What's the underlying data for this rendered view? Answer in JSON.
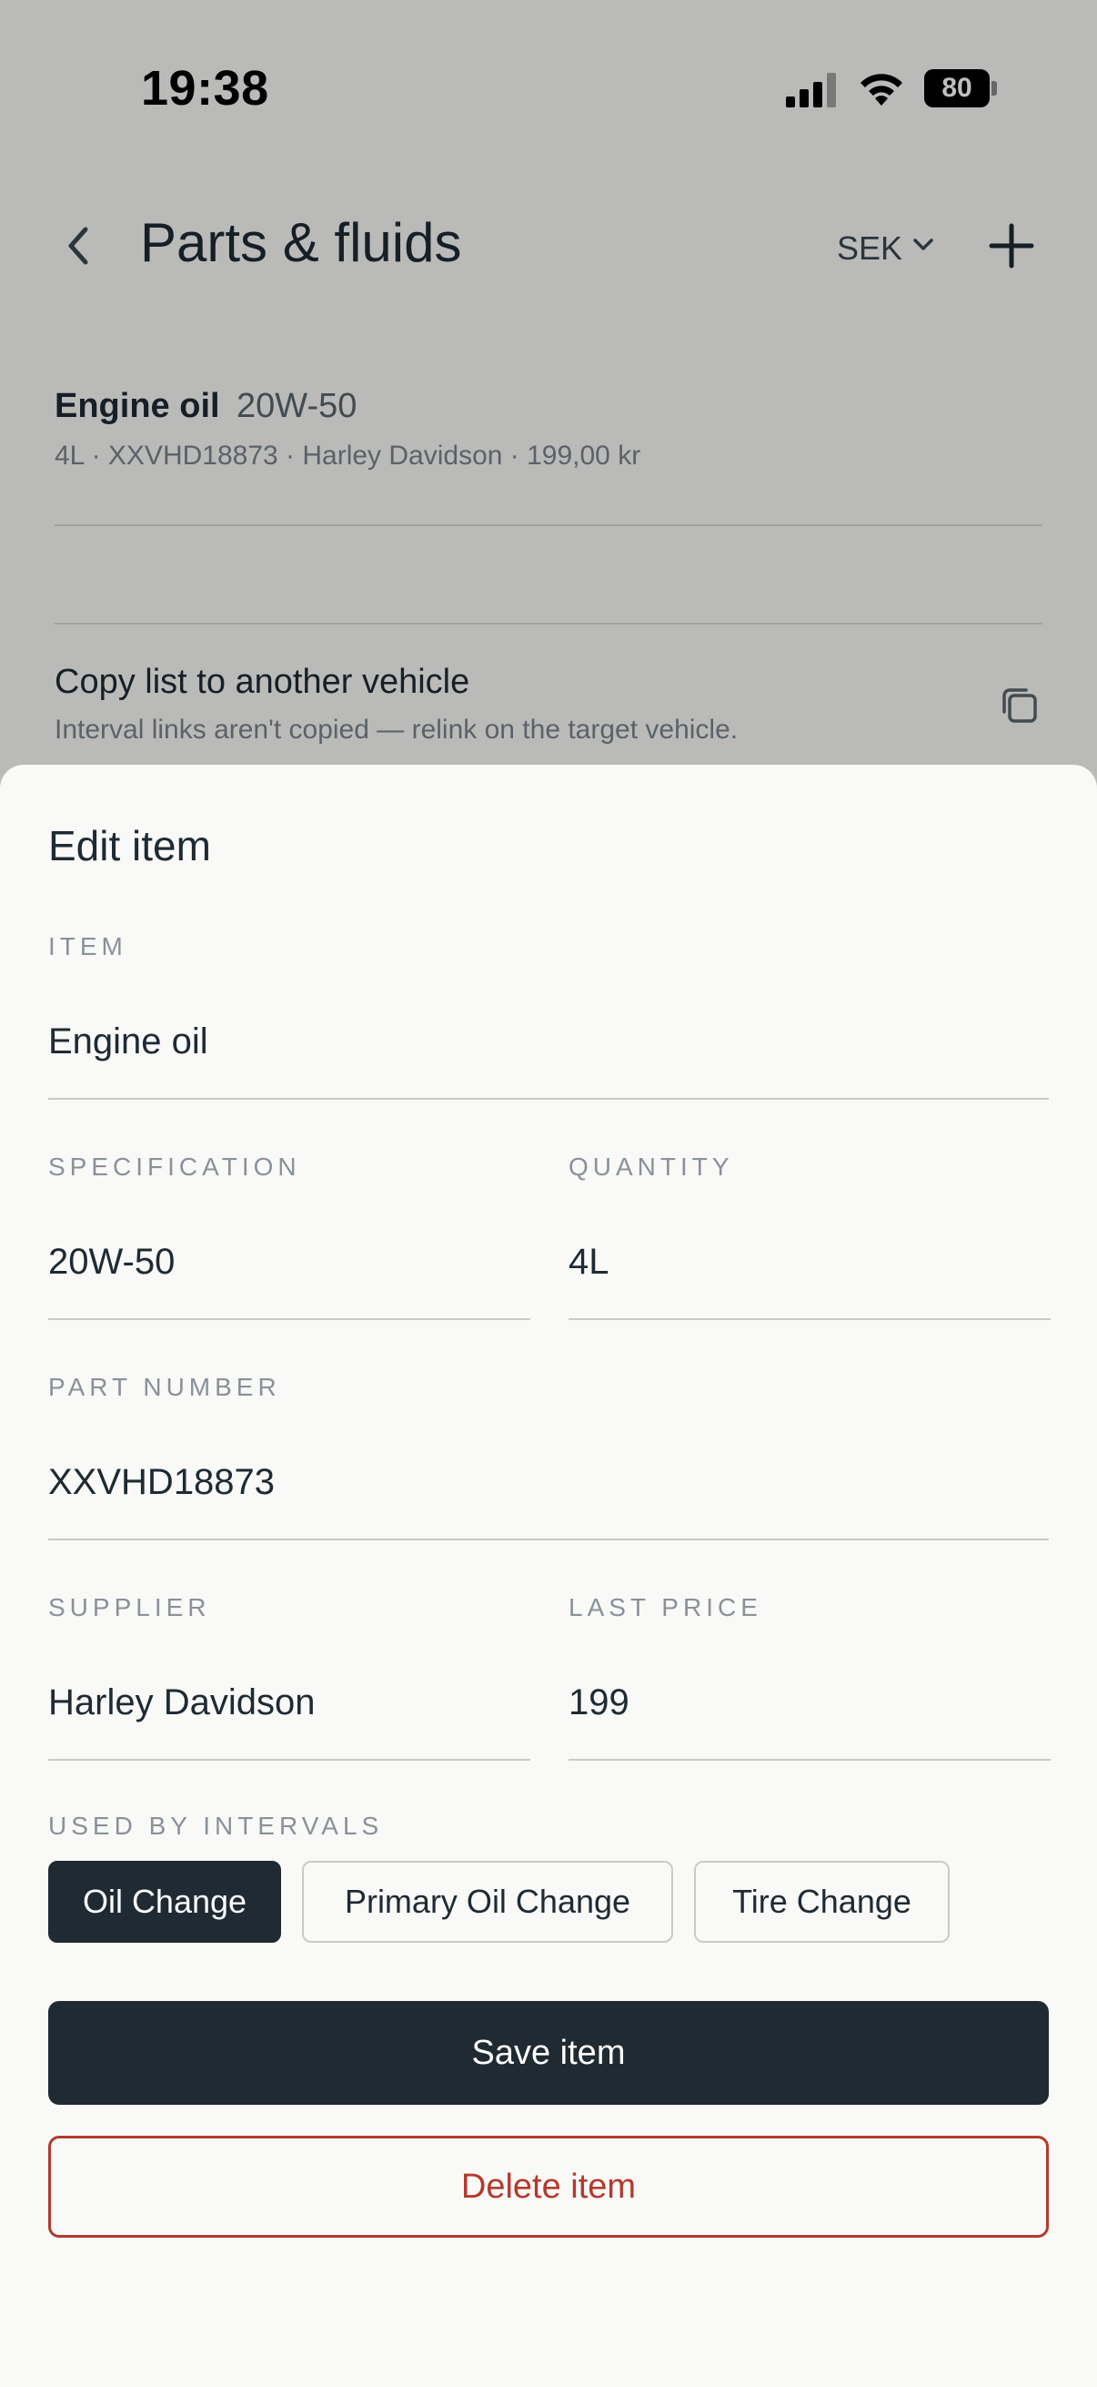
{
  "status_bar": {
    "time": "19:38",
    "battery": "80"
  },
  "header": {
    "title": "Parts & fluids",
    "currency": "SEK"
  },
  "part": {
    "name": "Engine oil",
    "spec": "20W-50",
    "meta": "4L · XXVHD18873 · Harley Davidson · 199,00 kr"
  },
  "copy": {
    "title": "Copy list to another vehicle",
    "subtitle": "Interval links aren't copied — relink on the target vehicle."
  },
  "sheet": {
    "title": "Edit item",
    "item_label": "ITEM",
    "item_value": "Engine oil",
    "spec_label": "SPECIFICATION",
    "spec_value": "20W-50",
    "qty_label": "QUANTITY",
    "qty_value": "4L",
    "partno_label": "PART NUMBER",
    "partno_value": "XXVHD18873",
    "supplier_label": "SUPPLIER",
    "supplier_value": "Harley Davidson",
    "price_label": "LAST PRICE",
    "price_value": "199",
    "intervals_label": "USED BY INTERVALS",
    "intervals": [
      {
        "label": "Oil Change",
        "selected": true
      },
      {
        "label": "Primary Oil Change",
        "selected": false
      },
      {
        "label": "Tire Change",
        "selected": false
      }
    ],
    "save_label": "Save item",
    "delete_label": "Delete item"
  },
  "colors": {
    "primary": "#1f2a33",
    "danger": "#b33a2d",
    "background": "#f9f9f7"
  }
}
